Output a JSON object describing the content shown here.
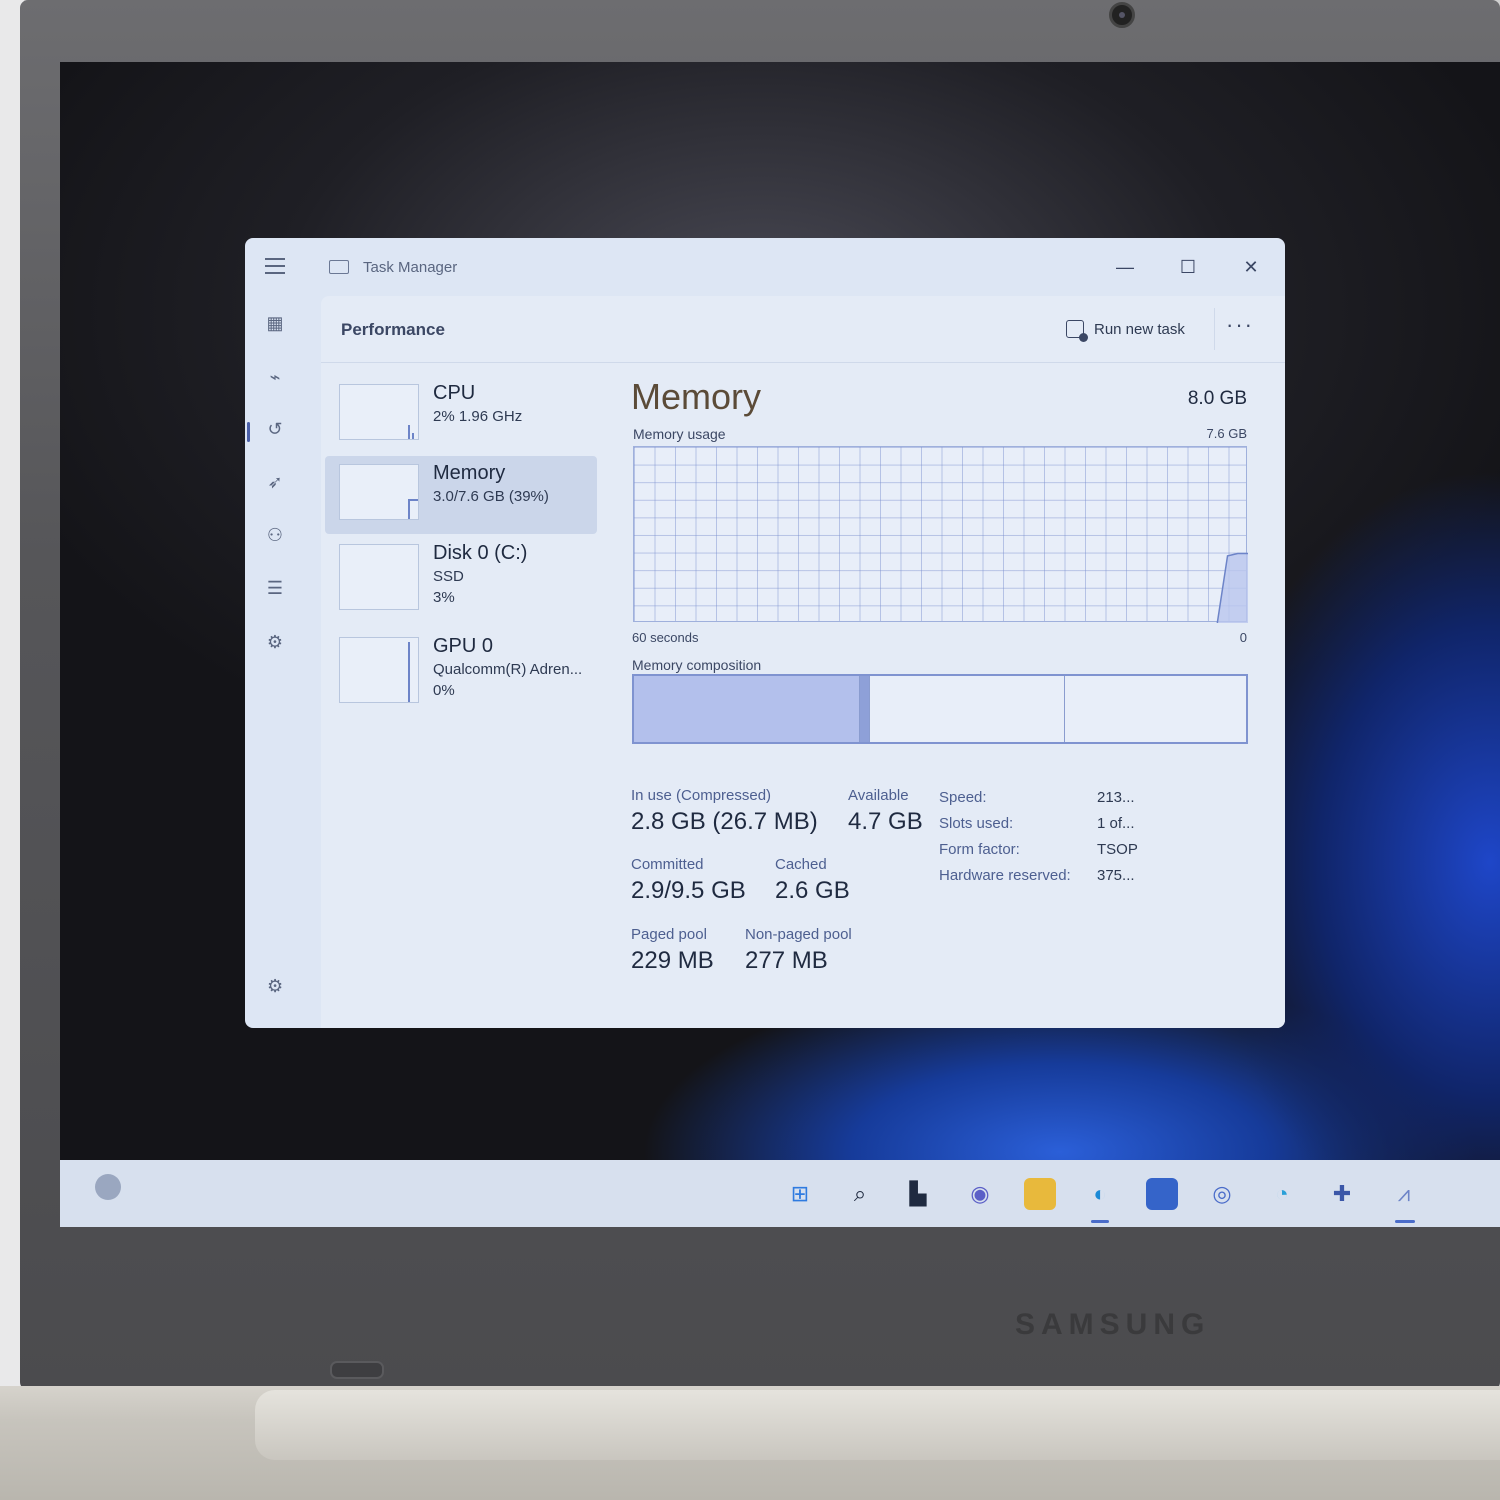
{
  "device": {
    "brand": "SAMSUNG"
  },
  "window": {
    "title": "Task Manager",
    "controls": {
      "minimize": "—",
      "maximize": "☐",
      "close": "✕"
    }
  },
  "header": {
    "page_title": "Performance",
    "run_new_task": "Run new task",
    "more": "···"
  },
  "nav": {
    "icons": [
      "hamburger-icon",
      "processes-icon",
      "performance-icon",
      "app-history-icon",
      "startup-apps-icon",
      "users-icon",
      "details-icon",
      "services-icon",
      "settings-icon"
    ],
    "selected": "performance"
  },
  "resources": [
    {
      "name": "CPU",
      "sub1": "2%  1.96 GHz",
      "sub2": "",
      "sub3": ""
    },
    {
      "name": "Memory",
      "sub1": "3.0/7.6 GB (39%)",
      "sub2": "",
      "sub3": ""
    },
    {
      "name": "Disk 0 (C:)",
      "sub1": "SSD",
      "sub2": "3%",
      "sub3": ""
    },
    {
      "name": "GPU 0",
      "sub1": "Qualcomm(R) Adren...",
      "sub2": "0%",
      "sub3": ""
    }
  ],
  "detail": {
    "title": "Memory",
    "total": "8.0 GB",
    "usage_label": "Memory usage",
    "usage_max": "7.6 GB",
    "x_left": "60 seconds",
    "x_right": "0",
    "composition_label": "Memory composition",
    "in_use_label": "In use (Compressed)",
    "in_use_value": "2.8 GB (26.7 MB)",
    "available_label": "Available",
    "available_value": "4.7 GB",
    "committed_label": "Committed",
    "committed_value": "2.9/9.5 GB",
    "cached_label": "Cached",
    "cached_value": "2.6 GB",
    "paged_label": "Paged pool",
    "paged_value": "229 MB",
    "nonpaged_label": "Non-paged pool",
    "nonpaged_value": "277 MB",
    "specs": [
      {
        "label": "Speed:",
        "value": "213..."
      },
      {
        "label": "Slots used:",
        "value": "1 of..."
      },
      {
        "label": "Form factor:",
        "value": "TSOP"
      },
      {
        "label": "Hardware reserved:",
        "value": "375..."
      }
    ]
  },
  "chart_data": {
    "type": "area",
    "title": "Memory usage",
    "xlabel": "60 seconds",
    "ylabel": "",
    "ylim": [
      0,
      7.6
    ],
    "x": [
      60,
      57,
      54,
      51,
      48,
      45,
      42,
      39,
      36,
      33,
      30,
      27,
      24,
      21,
      18,
      15,
      12,
      9,
      6,
      4,
      3,
      2,
      1,
      0
    ],
    "series": [
      {
        "values": [
          null,
          null,
          null,
          null,
          null,
          null,
          null,
          null,
          null,
          null,
          null,
          null,
          null,
          null,
          null,
          null,
          null,
          null,
          null,
          null,
          0,
          2.9,
          3.0,
          3.0
        ]
      }
    ],
    "composition": {
      "in_use_fraction": 0.37,
      "modified_fraction": 0.015,
      "standby_fraction": 0.32,
      "free_fraction": 0.295
    }
  },
  "taskbar": {
    "icons": [
      "start-icon",
      "search-icon",
      "task-view-icon",
      "chat-icon",
      "file-explorer-icon",
      "edge-icon",
      "store-icon",
      "app-icon-1",
      "app-icon-2",
      "app-icon-3",
      "task-manager-icon"
    ]
  },
  "colors": {
    "accent": "#4a6cc9",
    "graph_fill": "#b9c6ee",
    "graph_line": "#6d84c8"
  }
}
